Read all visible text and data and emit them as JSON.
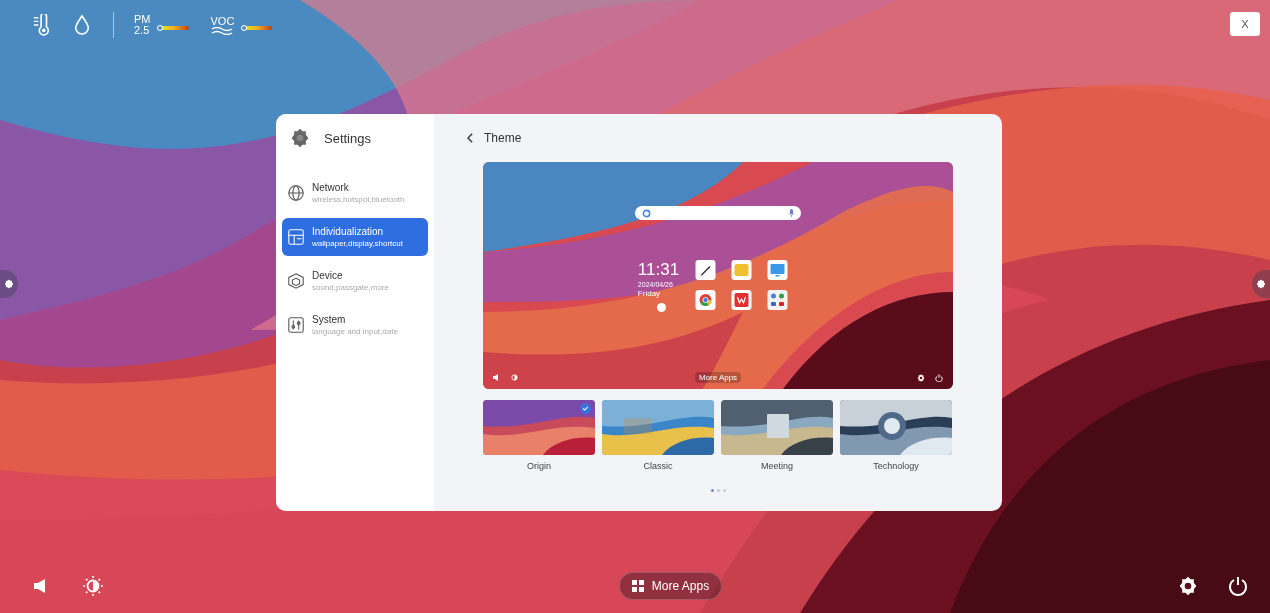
{
  "status_bar": {
    "sensors": [
      {
        "kind": "temperature"
      },
      {
        "kind": "humidity"
      },
      {
        "kind": "pm",
        "label": "PM",
        "sub": "2.5",
        "level": 0.05
      },
      {
        "kind": "voc",
        "label": "VOC",
        "level": 0.05
      }
    ]
  },
  "close_button": {
    "label": "X"
  },
  "settings": {
    "title": "Settings",
    "menu": [
      {
        "kind": "network",
        "title": "Network",
        "subtitle": "wireless,hotspot,bluetooth",
        "selected": false
      },
      {
        "kind": "individualization",
        "title": "Individualization",
        "subtitle": "wallpaper,display,shortcut",
        "selected": true
      },
      {
        "kind": "device",
        "title": "Device",
        "subtitle": "sound,passgate,more",
        "selected": false
      },
      {
        "kind": "system",
        "title": "System",
        "subtitle": "language and input,date",
        "selected": false
      }
    ]
  },
  "theme": {
    "title": "Theme",
    "preview": {
      "time": "11:31",
      "date": "2024/04/26",
      "day": "Friday",
      "more_apps": "More Apps"
    },
    "themes": [
      {
        "name": "Origin",
        "selected": true
      },
      {
        "name": "Classic",
        "selected": false
      },
      {
        "name": "Meeting",
        "selected": false
      },
      {
        "name": "Technology",
        "selected": false
      }
    ],
    "pages": [
      {
        "selected": true
      },
      {
        "selected": false
      },
      {
        "selected": false
      }
    ]
  },
  "bottom_bar": {
    "more_apps": "More Apps"
  }
}
